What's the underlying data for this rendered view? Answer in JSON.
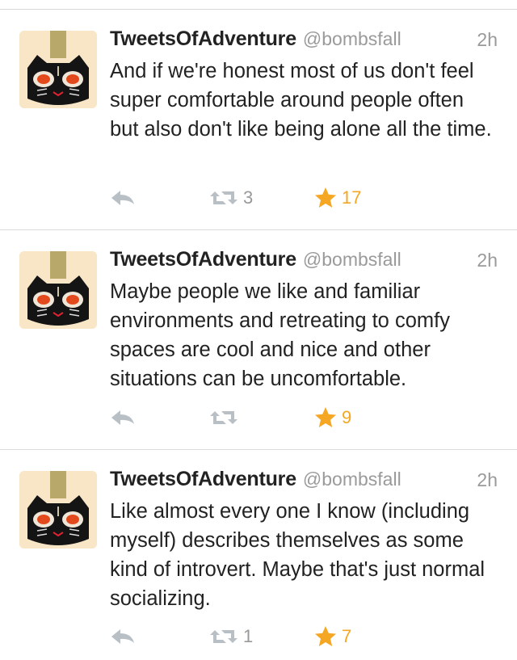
{
  "colors": {
    "favorite": "#f5a623",
    "icon_gray": "#b8bfc5",
    "meta_gray": "#9a9a9a"
  },
  "tweets": [
    {
      "name": "TweetsOfAdventure",
      "handle": "@bombsfall",
      "time": "2h",
      "text": "And if we're honest most of us don't feel super comfortable around people often but also don't like being alone all the time.",
      "retweets": "3",
      "favorites": "17",
      "avatar_icon": "black-cat-avatar-icon"
    },
    {
      "name": "TweetsOfAdventure",
      "handle": "@bombsfall",
      "time": "2h",
      "text": "Maybe people we like and familiar environments and retreating to comfy spaces are cool and nice and other situations can be uncomfortable.",
      "retweets": "",
      "favorites": "9",
      "avatar_icon": "black-cat-avatar-icon"
    },
    {
      "name": "TweetsOfAdventure",
      "handle": "@bombsfall",
      "time": "2h",
      "text": "Like almost every one I know (including myself) describes themselves as some kind of introvert. Maybe that's just normal socializing.",
      "retweets": "1",
      "favorites": "7",
      "avatar_icon": "black-cat-avatar-icon"
    }
  ]
}
